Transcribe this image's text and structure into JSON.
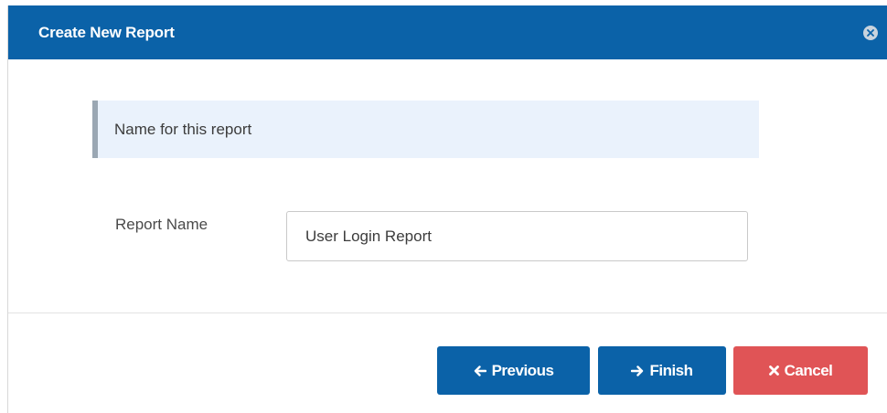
{
  "dialog": {
    "title": "Create New Report",
    "close_icon": "close-circle-icon"
  },
  "info": {
    "text": "Name for this report"
  },
  "form": {
    "report_name_label": "Report Name",
    "report_name_value": "User Login Report"
  },
  "footer": {
    "previous_label": "Previous",
    "previous_icon": "arrow-left-icon",
    "finish_label": "Finish",
    "finish_icon": "arrow-right-icon",
    "cancel_label": "Cancel",
    "cancel_icon": "times-icon"
  },
  "colors": {
    "header": "#0b62a8",
    "primary_button": "#0b62a8",
    "danger_button": "#e05456",
    "info_background": "#eaf2fc",
    "info_border": "#9aa7b3"
  }
}
